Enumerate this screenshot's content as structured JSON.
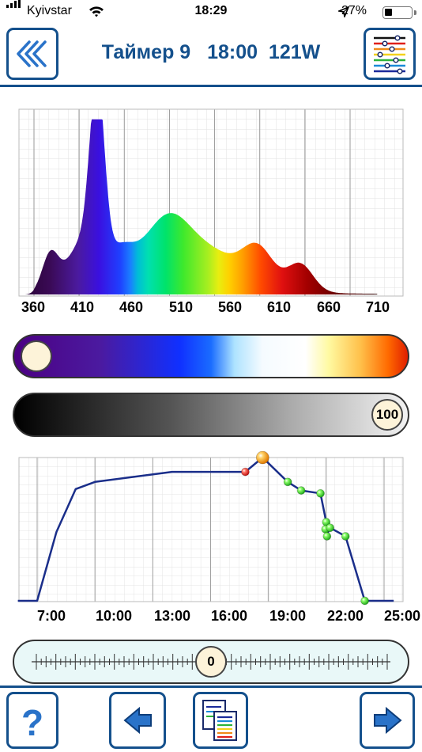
{
  "status_bar": {
    "carrier": "Kyivstar",
    "time": "18:29",
    "battery": "27%",
    "battery_level": 0.27
  },
  "header": {
    "timer_label": "Таймер 9",
    "time": "18:00",
    "power": "121W"
  },
  "spectrum_chart": {
    "x_ticks": [
      "360",
      "410",
      "460",
      "510",
      "560",
      "610",
      "660",
      "710"
    ],
    "peaks_nm": [
      {
        "nm": 382,
        "rel": 0.22
      },
      {
        "nm": 430,
        "rel": 1.0
      },
      {
        "nm": 510,
        "rel": 0.4
      },
      {
        "nm": 608,
        "rel": 0.24
      },
      {
        "nm": 655,
        "rel": 0.17
      }
    ]
  },
  "color_slider": {
    "value": 0
  },
  "intensity_slider": {
    "value": "100"
  },
  "chart_data": {
    "type": "line",
    "x_ticks": [
      "7:00",
      "10:00",
      "13:00",
      "16:00",
      "19:00",
      "22:00",
      "25:00"
    ],
    "x": [
      5.0,
      6.0,
      7.0,
      8.0,
      9.0,
      13.0,
      16.8,
      17.7,
      19.0,
      19.7,
      20.7,
      21.0,
      21.0,
      21.0,
      21.2,
      22.0,
      23.0,
      24.5
    ],
    "y": [
      0,
      0,
      48,
      78,
      83,
      90,
      90,
      100,
      83,
      77,
      75,
      55,
      50,
      45,
      51,
      45,
      0,
      0
    ],
    "point_colors": [
      "none",
      "none",
      "none",
      "none",
      "none",
      "none",
      "red",
      "orange",
      "green",
      "green",
      "green",
      "green",
      "green",
      "green",
      "green",
      "green",
      "green",
      "none"
    ],
    "line_color": "#1a2e8a"
  },
  "time_offset": {
    "value": "0"
  },
  "colors": {
    "accent": "#14508c"
  }
}
